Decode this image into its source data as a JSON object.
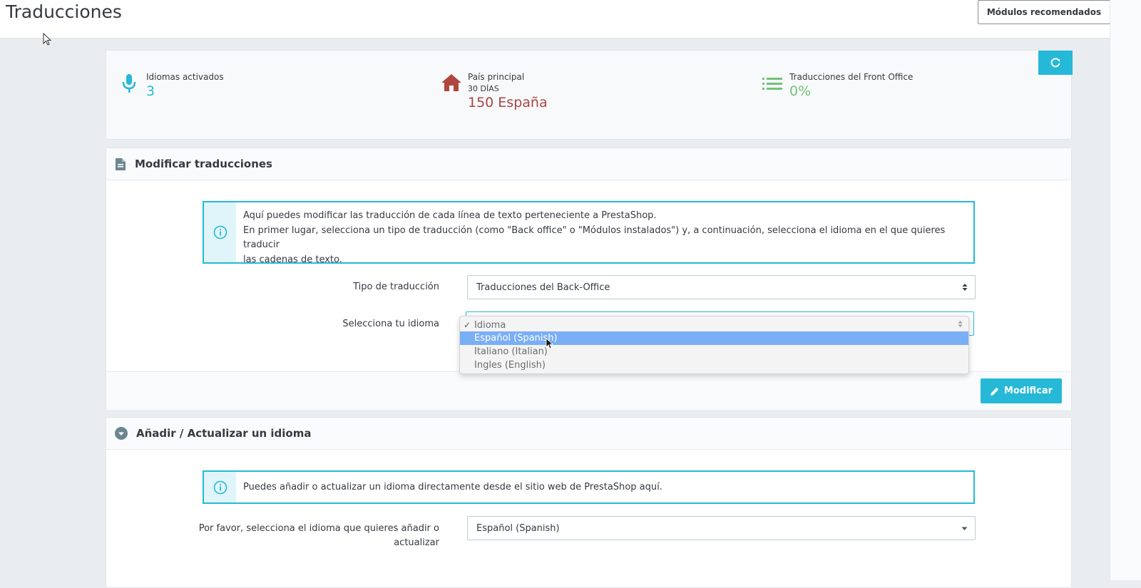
{
  "header": {
    "title": "Traducciones",
    "recommended_modules": "Módulos recomendados"
  },
  "kpis": {
    "languages": {
      "label": "Idiomas activados",
      "value": "3",
      "color": "#25b9d7"
    },
    "country": {
      "label": "País principal",
      "sub": "30 DÍAS",
      "value": "150 España",
      "color": "#a94442"
    },
    "front_office": {
      "label": "Traducciones del Front Office",
      "value": "0%",
      "color": "#72c279"
    }
  },
  "modify_panel": {
    "title": "Modificar traducciones",
    "info_line1": "Aquí puedes modificar las traducción de cada línea de texto perteneciente a PrestaShop.",
    "info_line2": "En primer lugar, selecciona un tipo de traducción (como \"Back office\" o \"Módulos instalados\") y, a continuación, selecciona el idioma en el que quieres traducir",
    "info_line3": "las cadenas de texto.",
    "type_label": "Tipo de traducción",
    "type_value": "Traducciones del Back-Office",
    "language_label": "Selecciona tu idioma",
    "language_options": [
      "Idioma",
      "Español (Spanish)",
      "Italiano (Italian)",
      "Ingles (English)"
    ],
    "modify_button": "Modificar"
  },
  "add_panel": {
    "title": "Añadir / Actualizar un idioma",
    "info": "Puedes añadir o actualizar un idioma directamente desde el sitio web de PrestaShop aquí.",
    "language_label_line1": "Por favor, selecciona el idioma que quieres añadir o",
    "language_label_line2": "actualizar",
    "language_value": "Español (Spanish)"
  },
  "colors": {
    "accent": "#25b9d7",
    "highlight": "#7aaef5"
  }
}
